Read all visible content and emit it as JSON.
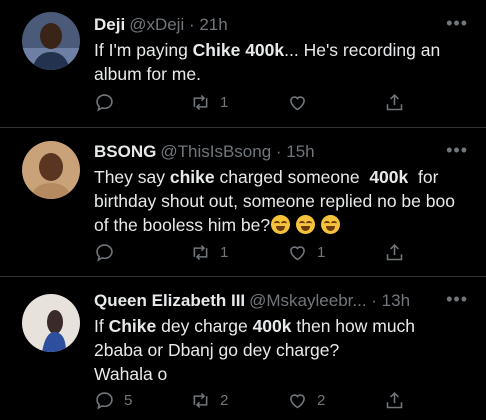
{
  "tweets": [
    {
      "name": "Deji",
      "handle": "@xDeji · 21h",
      "text": [
        {
          "t": "If I'm paying "
        },
        {
          "t": "Chike 400k",
          "b": true
        },
        {
          "t": "... He's recording an album for me."
        }
      ],
      "replies": "",
      "retweets": "1",
      "likes": ""
    },
    {
      "name": "BSONG",
      "handle": "@ThisIsBsong · 15h",
      "text": [
        {
          "t": "They say "
        },
        {
          "t": "chike",
          "b": true
        },
        {
          "t": " charged someone  "
        },
        {
          "t": "400k",
          "b": true
        },
        {
          "t": "  for birthday shout out, someone replied no be boo of the booless him be?"
        }
      ],
      "emoji": [
        "face-with-tears-of-joy",
        "face-with-tears-of-joy",
        "face-with-tears-of-joy"
      ],
      "replies": "",
      "retweets": "1",
      "likes": "1"
    },
    {
      "name": "Queen Elizabeth III",
      "handle": "@Mskayleebr... · 13h",
      "text": [
        {
          "t": "If "
        },
        {
          "t": "Chike",
          "b": true
        },
        {
          "t": " dey charge "
        },
        {
          "t": "400k",
          "b": true
        },
        {
          "t": " then how much 2baba or Dbanj go dey charge?"
        }
      ],
      "text_line2": "Wahala o",
      "replies": "5",
      "retweets": "2",
      "likes": "2"
    }
  ],
  "more_icon": "•••",
  "colors": {
    "background": "#000000",
    "text": "#e7e9ea",
    "muted": "#71767b",
    "divider": "#2f3336"
  }
}
